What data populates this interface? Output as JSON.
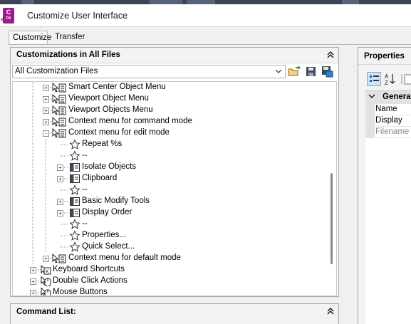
{
  "window": {
    "title": "Customize User Interface",
    "app_icon_letter": "C",
    "app_icon_sub": "DX",
    "side_letter": "e"
  },
  "tabs": [
    {
      "label": "Customize",
      "active": true
    },
    {
      "label": "Transfer",
      "active": false
    }
  ],
  "customizations": {
    "header": "Customizations in All Files",
    "collapse_icon": "double-chevron-up-icon",
    "dropdown_value": "All Customization Files",
    "toolbar_icons": [
      "open-folder-icon",
      "save-icon",
      "save-as-icon"
    ]
  },
  "tree": [
    {
      "label": "Smart Center Object Menu",
      "icon": "context-menu-icon",
      "expander": "+"
    },
    {
      "label": "Viewport Object Menu",
      "icon": "context-menu-icon",
      "expander": "+"
    },
    {
      "label": "Viewport Objects Menu",
      "icon": "context-menu-icon",
      "expander": "+"
    },
    {
      "label": "Context menu for command mode",
      "icon": "context-menu-icon",
      "expander": "+"
    },
    {
      "label": "Context menu for edit mode",
      "icon": "context-menu-icon",
      "expander": "-"
    },
    {
      "label": "Repeat %s",
      "icon": "star-icon",
      "expander": ""
    },
    {
      "label": "--",
      "icon": "star-icon",
      "expander": ""
    },
    {
      "label": "Isolate Objects",
      "icon": "submenu-icon",
      "expander": "+"
    },
    {
      "label": "Clipboard",
      "icon": "submenu-icon",
      "expander": "+"
    },
    {
      "label": "--",
      "icon": "star-icon",
      "expander": ""
    },
    {
      "label": "Basic Modify Tools",
      "icon": "submenu-icon",
      "expander": "+"
    },
    {
      "label": "Display Order",
      "icon": "submenu-icon",
      "expander": "+"
    },
    {
      "label": "--",
      "icon": "star-icon",
      "expander": ""
    },
    {
      "label": "Properties...",
      "icon": "star-icon",
      "expander": ""
    },
    {
      "label": "Quick Select...",
      "icon": "star-icon",
      "expander": ""
    },
    {
      "label": "Context menu for default mode",
      "icon": "context-menu-icon",
      "expander": "+"
    },
    {
      "label": "Keyboard Shortcuts",
      "icon": "keyboard-shortcut-icon",
      "expander": "+"
    },
    {
      "label": "Double Click Actions",
      "icon": "mouse-icon",
      "expander": "+"
    },
    {
      "label": "Mouse Buttons",
      "icon": "mouse-icon",
      "expander": "+"
    }
  ],
  "command_list": {
    "header": "Command List:",
    "collapse_icon": "double-chevron-up-icon"
  },
  "properties": {
    "header": "Properties",
    "category": "General",
    "rows": [
      "Name",
      "Display",
      "Filename"
    ]
  },
  "colors": {
    "app_icon": "#9b1b8e",
    "title_bar": "#ffffff",
    "panel_header": "#f3f3f3",
    "window_bg": "#f0f0f0"
  }
}
